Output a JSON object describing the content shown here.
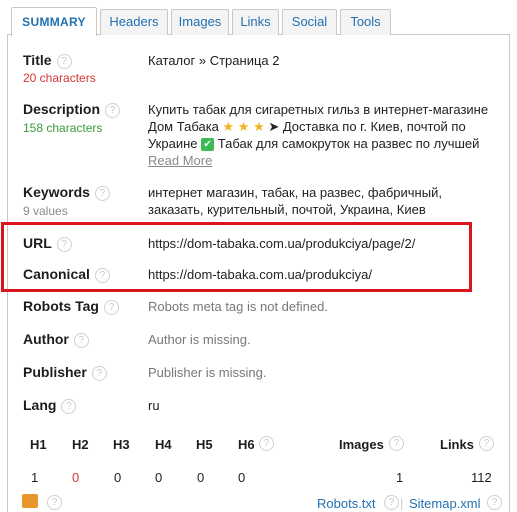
{
  "tabs": [
    {
      "label": "SUMMARY"
    },
    {
      "label": "Headers"
    },
    {
      "label": "Images"
    },
    {
      "label": "Links"
    },
    {
      "label": "Social"
    },
    {
      "label": "Tools"
    }
  ],
  "help_glyph": "?",
  "title": {
    "label": "Title",
    "count": "20 characters",
    "value": "Каталог » Страница 2"
  },
  "description": {
    "label": "Description",
    "count": "158 characters",
    "line1": "Купить табак для сигаретных гильз в интернет-магазине",
    "line2_start": "Дом Табака",
    "stars": "★ ★ ★",
    "line2_end": "➤ Доставка по г. Киев, почтой по",
    "line3_start": "Украине",
    "check": "✔",
    "line3_end": "Табак для самокруток на развес по лучшей",
    "read_more": "Read More"
  },
  "keywords": {
    "label": "Keywords",
    "count": "9 values",
    "value": "интернет магазин, табак, на развес, фабричный, заказать, курительный, почтой, Украина, Киев"
  },
  "url": {
    "label": "URL",
    "value": "https://dom-tabaka.com.ua/produkciya/page/2/"
  },
  "canonical": {
    "label": "Canonical",
    "value": "https://dom-tabaka.com.ua/produkciya/"
  },
  "robots_tag": {
    "label": "Robots Tag",
    "value": "Robots meta tag is not defined."
  },
  "author": {
    "label": "Author",
    "value": "Author is missing."
  },
  "publisher": {
    "label": "Publisher",
    "value": "Publisher is missing."
  },
  "lang": {
    "label": "Lang",
    "value": "ru"
  },
  "headings": {
    "h1": {
      "label": "H1",
      "value": "1"
    },
    "h2": {
      "label": "H2",
      "value": "0"
    },
    "h3": {
      "label": "H3",
      "value": "0"
    },
    "h4": {
      "label": "H4",
      "value": "0"
    },
    "h5": {
      "label": "H5",
      "value": "0"
    },
    "h6": {
      "label": "H6",
      "value": "0"
    },
    "images": {
      "label": "Images",
      "value": "1"
    },
    "links": {
      "label": "Links",
      "value": "112"
    }
  },
  "footer": {
    "robots": "Robots.txt",
    "sitemap": "Sitemap.xml",
    "separator": "|"
  },
  "colors": {
    "accent": "#2271b1",
    "highlight": "#d9141c",
    "error": "#d63638",
    "success": "#3c9a3c"
  }
}
